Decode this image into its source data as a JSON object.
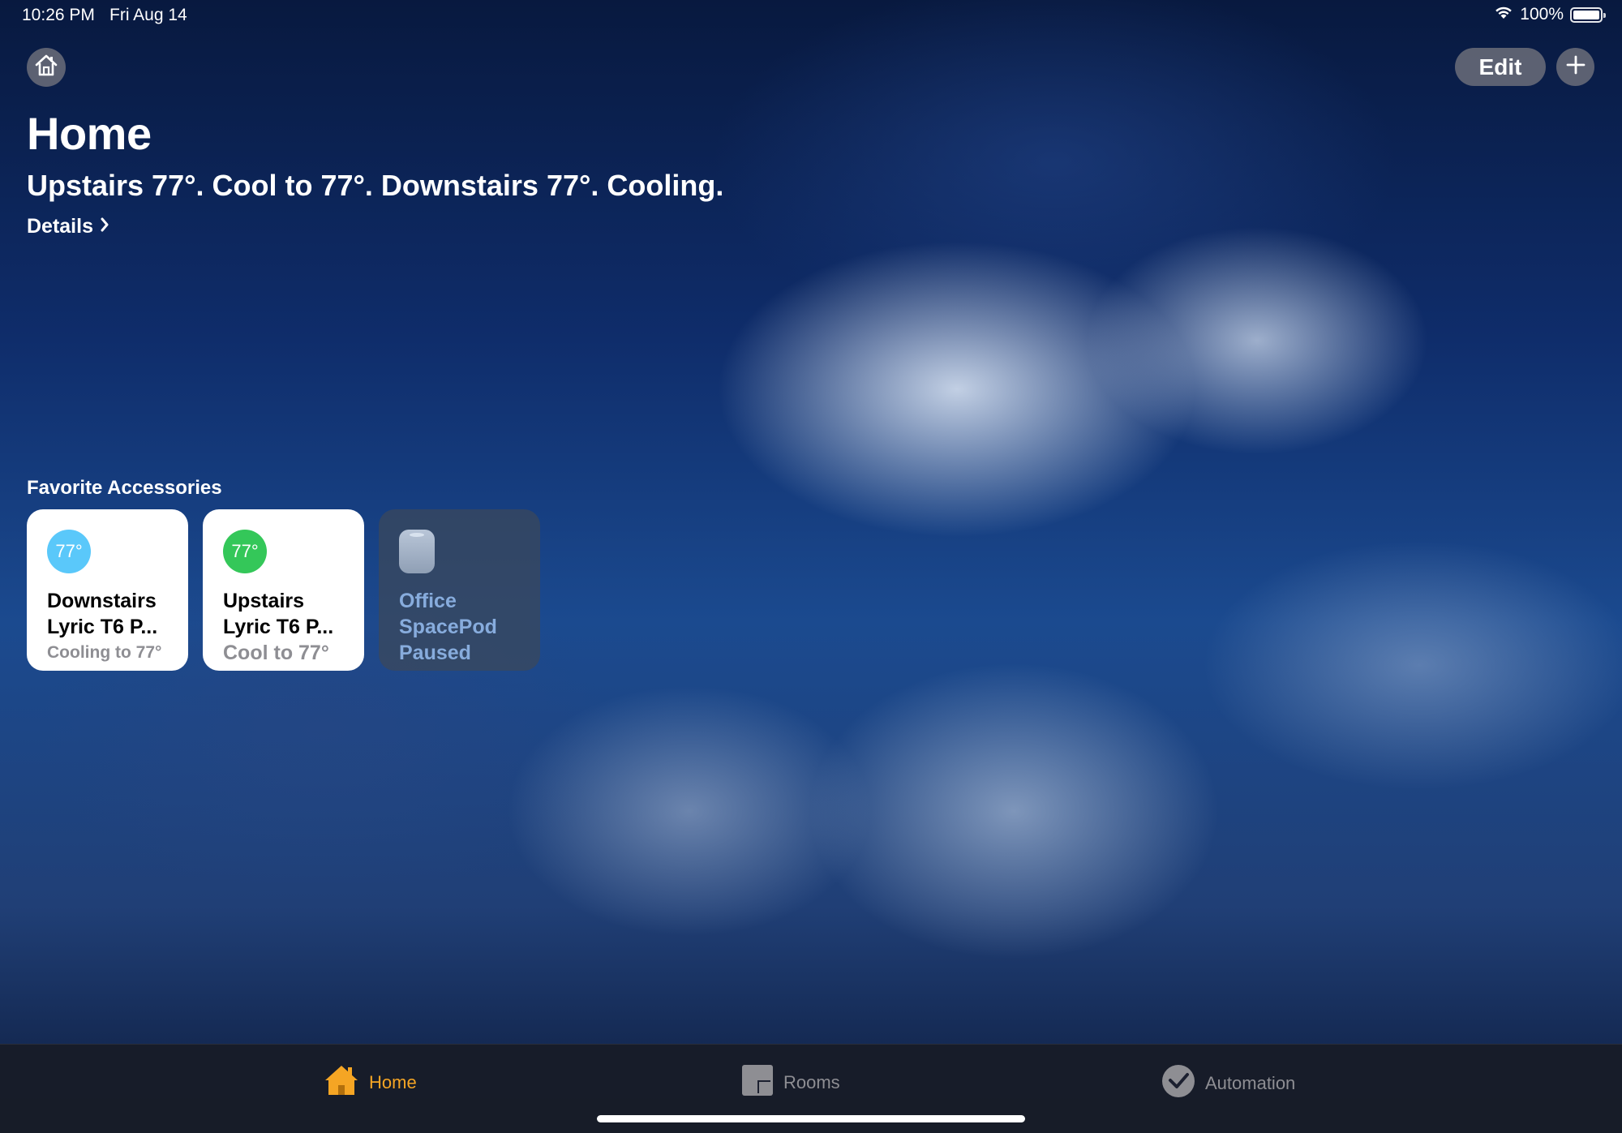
{
  "status_bar": {
    "time": "10:26 PM",
    "date": "Fri Aug 14",
    "battery": "100%",
    "icons": [
      "wifi-icon",
      "battery-icon"
    ]
  },
  "header": {
    "edit_label": "Edit",
    "title": "Home",
    "summary": "Upstairs 77°. Cool to 77°. Downstairs 77°. Cooling.",
    "details_label": "Details"
  },
  "favorites": {
    "section_title": "Favorite Accessories",
    "tiles": [
      {
        "badge": "77°",
        "badge_color": "#5ac8fa",
        "name_line1": "Downstairs",
        "name_line2": "Lyric T6 P...",
        "status": "Cooling to 77°",
        "active": true
      },
      {
        "badge": "77°",
        "badge_color": "#34c759",
        "name_line1": "Upstairs",
        "name_line2": "Lyric T6 P...",
        "status": "Cool to 77°",
        "active": true
      },
      {
        "icon": "homepod-speaker-icon",
        "name_line1": "Office",
        "name_line2": "SpacePod",
        "status": "Paused",
        "active": false
      }
    ]
  },
  "tab_bar": {
    "tabs": [
      {
        "label": "Home",
        "icon": "house-icon",
        "selected": true
      },
      {
        "label": "Rooms",
        "icon": "rooms-icon",
        "selected": false
      },
      {
        "label": "Automation",
        "icon": "automation-clock-icon",
        "selected": false
      }
    ],
    "selected_color": "#f5a524"
  }
}
